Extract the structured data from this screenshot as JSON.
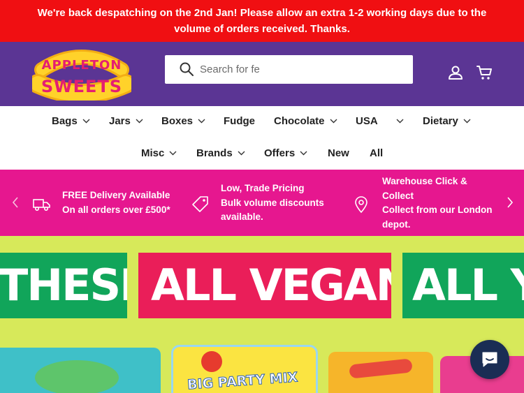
{
  "announcement": {
    "line1": "We're back despatching on the 2nd Jan! Please allow an extra 1-2 working days due to the",
    "line2": "volume of orders received. Thanks."
  },
  "header": {
    "logo_line1": "APPLETON",
    "logo_line2": "SWEETS",
    "search_placeholder": "Search for fe",
    "icons": [
      "account-icon",
      "cart-icon"
    ]
  },
  "nav": {
    "row1": [
      {
        "label": "Bags",
        "dropdown": true
      },
      {
        "label": "Jars",
        "dropdown": true
      },
      {
        "label": "Boxes",
        "dropdown": true
      },
      {
        "label": "Fudge",
        "dropdown": false
      },
      {
        "label": "Chocolate",
        "dropdown": true
      },
      {
        "label": "USA",
        "dropdown": true
      },
      {
        "label": "Dietary",
        "dropdown": true
      }
    ],
    "row2": [
      {
        "label": "Misc",
        "dropdown": true
      },
      {
        "label": "Brands",
        "dropdown": true
      },
      {
        "label": "Offers",
        "dropdown": true
      },
      {
        "label": "New",
        "dropdown": false
      },
      {
        "label": "All",
        "dropdown": false
      }
    ]
  },
  "usp": {
    "items": [
      {
        "icon": "truck-icon",
        "lines": [
          "FREE Delivery Available",
          "On all orders over £500*"
        ]
      },
      {
        "icon": "price-tag-icon",
        "lines": [
          "Low, Trade Pricing",
          "Bulk volume discounts",
          "available."
        ]
      },
      {
        "icon": "location-pin-icon",
        "lines": [
          "Warehouse Click &",
          "Collect",
          "Collect from our London",
          "depot."
        ]
      }
    ]
  },
  "hero": {
    "banner_words": [
      "THESE",
      "ALL VEGAN",
      "ALL Y"
    ],
    "bag_label": "BIG PARTY MIX",
    "colors": {
      "background": "#d7e95a",
      "green": "#11a55a",
      "pink": "#ea1e59"
    }
  },
  "colors": {
    "announcement": "#f00f12",
    "header": "#5b3594",
    "usp_bar": "#e6178f",
    "chat": "#1a2d54"
  }
}
